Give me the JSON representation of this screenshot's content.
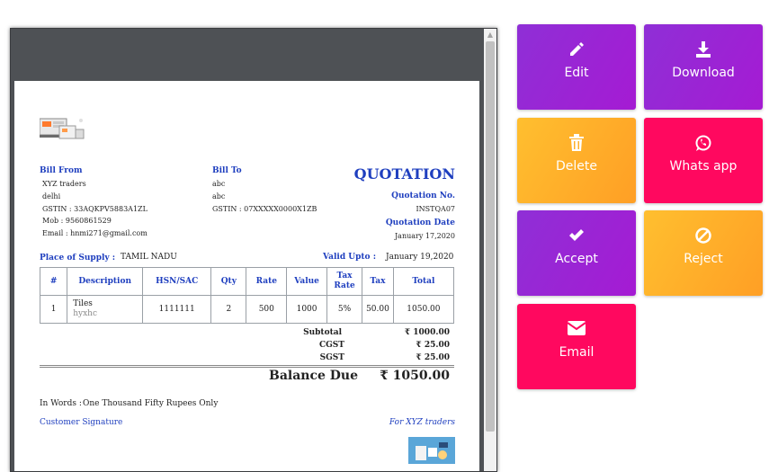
{
  "document": {
    "bill_from": {
      "heading": "Bill From",
      "lines": [
        "XYZ traders",
        "delhi",
        "GSTIN : 33AQKPV5883A1ZL",
        "Mob : 9560861529",
        "Email : hnmi271@gmail.com"
      ]
    },
    "bill_to": {
      "heading": "Bill To",
      "lines": [
        "abc",
        "abc",
        "GSTIN : 07XXXXX0000X1ZB"
      ]
    },
    "title": "QUOTATION",
    "quotation_no_label": "Quotation No.",
    "quotation_no": "INSTQA07",
    "quotation_date_label": "Quotation Date",
    "quotation_date": "January 17,2020",
    "place_of_supply_label": "Place of Supply :",
    "place_of_supply": "TAMIL NADU",
    "valid_upto_label": "Valid Upto :",
    "valid_upto": "January 19,2020",
    "table": {
      "headers": [
        "#",
        "Description",
        "HSN/SAC",
        "Qty",
        "Rate",
        "Value",
        "Tax Rate",
        "Tax",
        "Total"
      ],
      "rows": [
        {
          "num": "1",
          "desc": "Tiles",
          "desc_sub": "hyxhc",
          "hsn": "1111111",
          "qty": "2",
          "rate": "500",
          "value": "1000",
          "tax_rate": "5%",
          "tax": "50.00",
          "total": "1050.00"
        }
      ]
    },
    "subtotal_label": "Subtotal",
    "subtotal": "₹ 1000.00",
    "cgst_label": "CGST",
    "cgst": "₹ 25.00",
    "sgst_label": "SGST",
    "sgst": "₹ 25.00",
    "balance_label": "Balance Due",
    "balance": "₹ 1050.00",
    "in_words_label": "In Words :",
    "in_words": "One Thousand Fifty Rupees  Only",
    "customer_signature": "Customer Signature",
    "for_company": "For XYZ traders"
  },
  "actions": [
    {
      "id": "edit",
      "label": "Edit",
      "icon": "pencil-icon",
      "color": "#9b27d6"
    },
    {
      "id": "download",
      "label": "Download",
      "icon": "download-icon",
      "color": "#9b27d6"
    },
    {
      "id": "delete",
      "label": "Delete",
      "icon": "trash-icon",
      "color": "#ffb02b"
    },
    {
      "id": "whatsapp",
      "label": "Whats app",
      "icon": "whatsapp-icon",
      "color": "#ff085f"
    },
    {
      "id": "accept",
      "label": "Accept",
      "icon": "check-icon",
      "color": "#9b27d6"
    },
    {
      "id": "reject",
      "label": "Reject",
      "icon": "ban-icon",
      "color": "#ffb02b"
    },
    {
      "id": "email",
      "label": "Email",
      "icon": "envelope-icon",
      "color": "#ff085f"
    }
  ]
}
